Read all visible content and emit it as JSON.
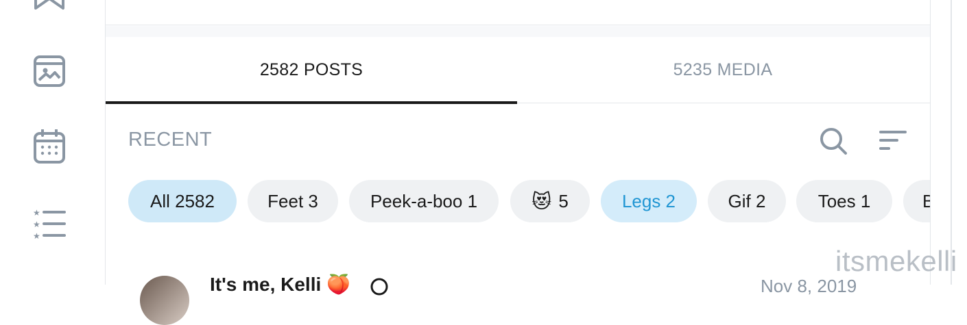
{
  "sidebar": {
    "items": [
      {
        "icon": "bookmark-icon"
      },
      {
        "icon": "image-icon"
      },
      {
        "icon": "calendar-icon"
      },
      {
        "icon": "starred-list-icon"
      }
    ]
  },
  "tabs": {
    "posts_label": "2582 POSTS",
    "media_label": "5235 MEDIA"
  },
  "filters": {
    "section_label": "RECENT",
    "chips": [
      {
        "label": "All 2582"
      },
      {
        "label": "Feet 3"
      },
      {
        "label": "Peek-a-boo 1"
      },
      {
        "label": "5",
        "emoji": "😻"
      },
      {
        "label": "Legs 2"
      },
      {
        "label": "Gif 2"
      },
      {
        "label": "Toes 1"
      },
      {
        "label": "B"
      }
    ]
  },
  "post": {
    "author": "It's me, Kelli 🍑",
    "date": "Nov 8, 2019"
  },
  "watermark": "itsmekelli",
  "colors": {
    "accent": "#2196d3",
    "muted": "#8a96a3",
    "chip_bg": "#eff1f3",
    "chip_selected_bg": "#cfe9f8"
  }
}
